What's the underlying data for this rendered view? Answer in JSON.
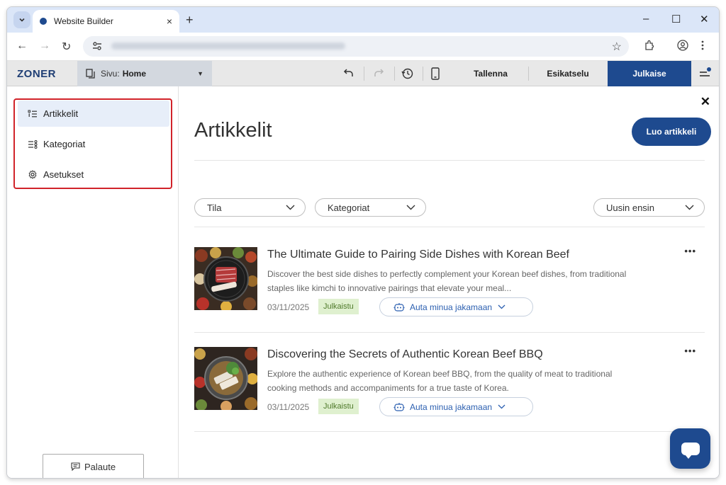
{
  "browser": {
    "tab_title": "Website Builder",
    "tab_close": "×",
    "new_tab": "+",
    "window_controls": {
      "minimize": "–",
      "maximize": "☐",
      "close": "✕"
    },
    "nav": {
      "back": "←",
      "forward": "→",
      "reload": "↻"
    }
  },
  "toolbar": {
    "logo": "ZONER",
    "page_label": "Sivu:",
    "page_value": "Home",
    "save_label": "Tallenna",
    "preview_label": "Esikatselu",
    "publish_label": "Julkaise"
  },
  "sidebar": {
    "items": [
      {
        "label": "Artikkelit",
        "icon": "list-icon",
        "active": true
      },
      {
        "label": "Kategoriat",
        "icon": "category-icon",
        "active": false
      },
      {
        "label": "Asetukset",
        "icon": "gear-icon",
        "active": false
      }
    ],
    "feedback_label": "Palaute"
  },
  "main": {
    "title": "Artikkelit",
    "create_label": "Luo artikkeli",
    "filters": {
      "status": "Tila",
      "category": "Kategoriat",
      "sort": "Uusin ensin"
    },
    "articles": [
      {
        "title": "The Ultimate Guide to Pairing Side Dishes with Korean Beef",
        "description": "Discover the best side dishes to perfectly complement your Korean beef dishes, from traditional staples like kimchi to innovative pairings that elevate your meal...",
        "date": "03/11/2025",
        "status": "Julkaistu",
        "share_label": "Auta minua jakamaan"
      },
      {
        "title": "Discovering the Secrets of Authentic Korean Beef BBQ",
        "description": "Explore the authentic experience of Korean beef BBQ, from the quality of meat to traditional cooking methods and accompaniments for a true taste of Korea.",
        "date": "03/11/2025",
        "status": "Julkaistu",
        "share_label": "Auta minua jakamaan"
      }
    ]
  },
  "colors": {
    "brand": "#1e4a8f",
    "highlight": "#d1232a",
    "badge_bg": "#dff0cf",
    "badge_text": "#4f7a2b"
  }
}
